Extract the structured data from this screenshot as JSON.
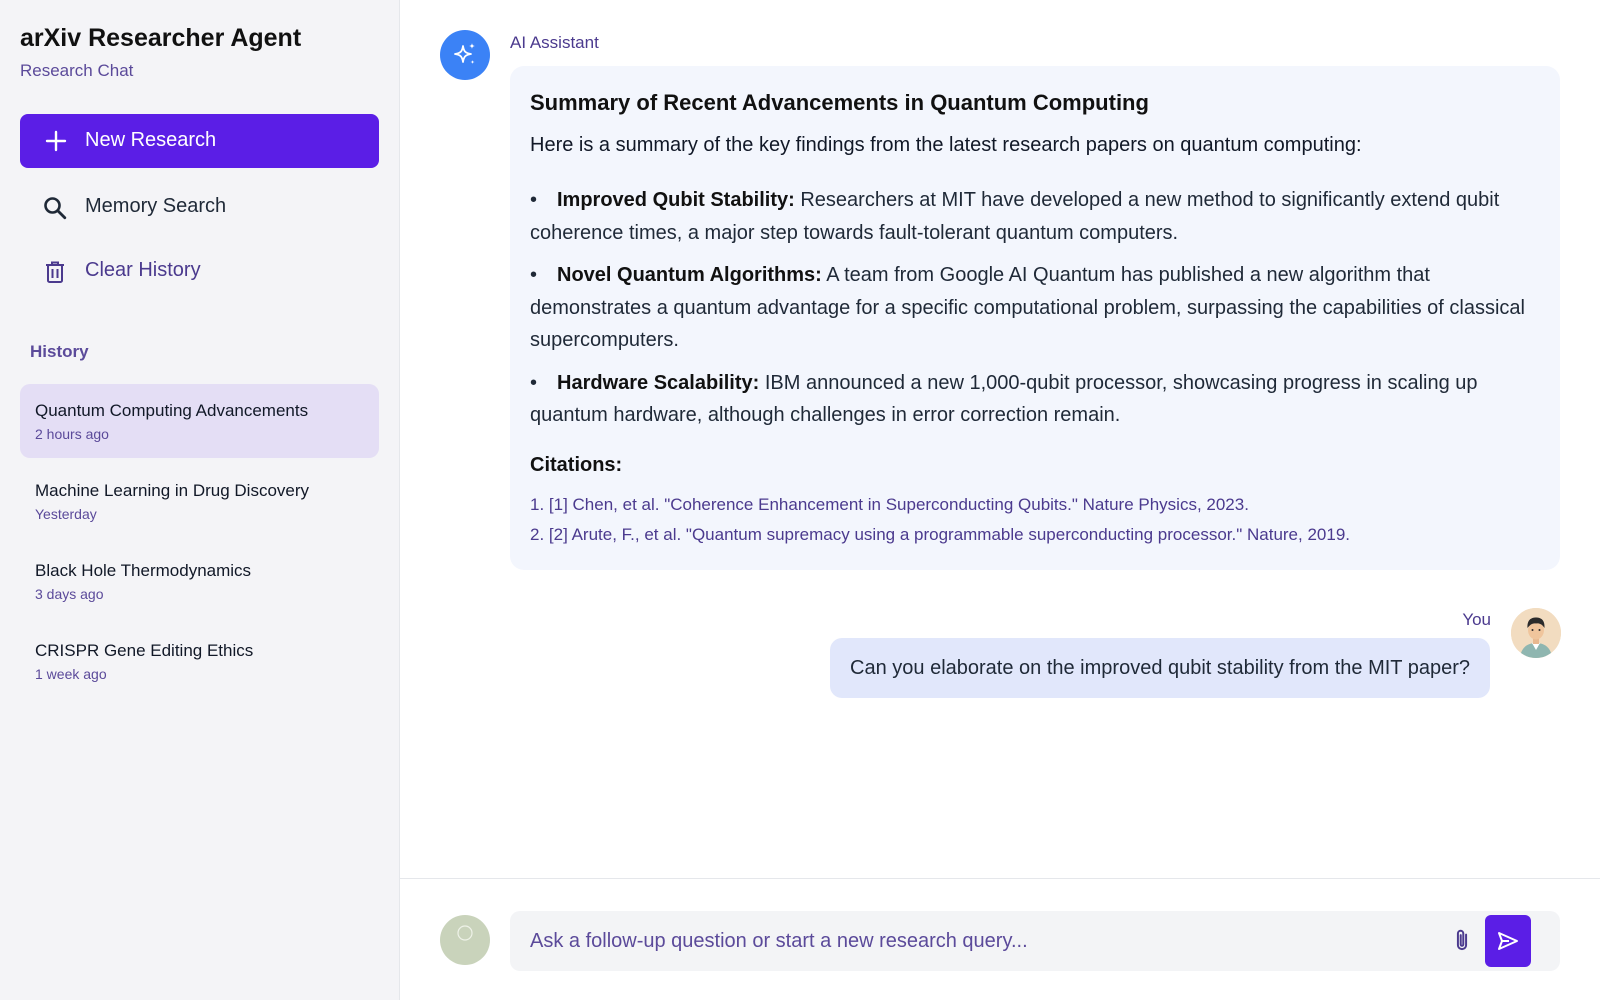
{
  "sidebar": {
    "app_title": "arXiv Researcher Agent",
    "app_subtitle": "Research Chat",
    "new_research_label": "New Research",
    "memory_search_label": "Memory Search",
    "clear_history_label": "Clear History",
    "history_heading": "History",
    "history": [
      {
        "title": "Quantum Computing Advancements",
        "time": "2 hours ago",
        "active": true
      },
      {
        "title": "Machine Learning in Drug Discovery",
        "time": "Yesterday",
        "active": false
      },
      {
        "title": "Black Hole Thermodynamics",
        "time": "3 days ago",
        "active": false
      },
      {
        "title": "CRISPR Gene Editing Ethics",
        "time": "1 week ago",
        "active": false
      }
    ]
  },
  "chat": {
    "assistant_name": "AI Assistant",
    "summary_title": "Summary of Recent Advancements in Quantum Computing",
    "summary_intro": "Here is a summary of the key findings from the latest research papers on quantum computing:",
    "bullets": [
      {
        "heading": "Improved Qubit Stability:",
        "text": " Researchers at MIT have developed a new method to significantly extend qubit coherence times, a major step towards fault-tolerant quantum computers."
      },
      {
        "heading": "Novel Quantum Algorithms:",
        "text": " A team from Google AI Quantum has published a new algorithm that demonstrates a quantum advantage for a specific computational problem, surpassing the capabilities of classical supercomputers."
      },
      {
        "heading": "Hardware Scalability:",
        "text": " IBM announced a new 1,000-qubit processor, showcasing progress in scaling up quantum hardware, although challenges in error correction remain."
      }
    ],
    "citations_heading": "Citations:",
    "citations": [
      "1. [1] Chen, et al. \"Coherence Enhancement in Superconducting Qubits.\" Nature Physics, 2023.",
      "2. [2] Arute, F., et al. \"Quantum supremacy using a programmable superconducting processor.\" Nature, 2019."
    ],
    "user_name": "You",
    "user_message": "Can you elaborate on the improved qubit stability from the MIT paper?"
  },
  "composer": {
    "placeholder": "Ask a follow-up question or start a new research query..."
  },
  "colors": {
    "accent": "#5b1ee6",
    "assistant_avatar": "#3b82f6",
    "active_history": "#e4def5",
    "assistant_bubble": "#f3f6fd",
    "user_bubble": "#e1e7fb"
  },
  "icons": {
    "new": "plus-icon",
    "search": "search-icon",
    "clear": "trash-icon",
    "assistant": "sparkles-icon",
    "attach": "paperclip-icon",
    "send": "send-icon"
  }
}
